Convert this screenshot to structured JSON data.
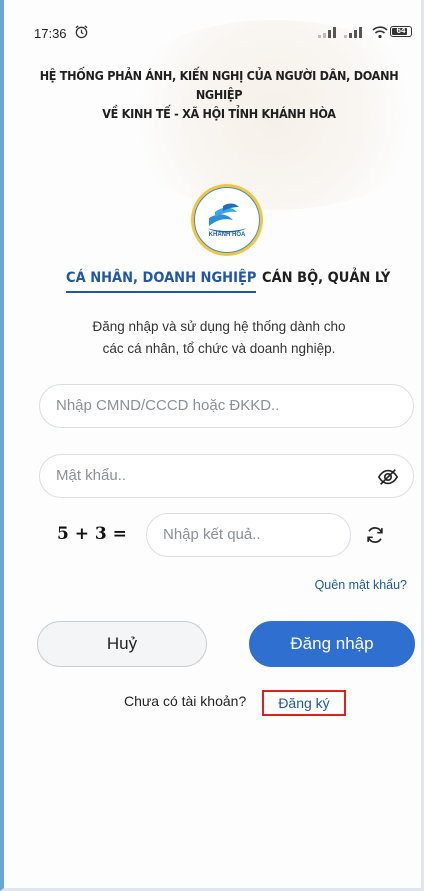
{
  "statusbar": {
    "time": "17:36",
    "battery": "64",
    "icons": [
      "alarm-icon",
      "signal-icon",
      "signal-icon",
      "wifi-icon",
      "battery-icon"
    ]
  },
  "header": {
    "title_line1": "HỆ THỐNG PHẢN ÁNH, KIẾN NGHỊ CỦA NGƯỜI DÂN, DOANH NGHIỆP",
    "title_line2": "VỀ KINH TẾ - XÃ HỘI TỈNH KHÁNH HÒA"
  },
  "logo": {
    "text": "KHÁNH HÒA"
  },
  "tabs": [
    {
      "label": "CÁ NHÂN, DOANH NGHIỆP",
      "active": true
    },
    {
      "label": "CÁN BỘ, QUẢN LÝ",
      "active": false
    }
  ],
  "description": {
    "line1": "Đăng nhập và sử dụng hệ thống dành cho",
    "line2": "các cá nhân, tổ chức và doanh nghiệp."
  },
  "form": {
    "id_placeholder": "Nhập CMND/CCCD hoặc ĐKKD..",
    "password_placeholder": "Mật khẩu..",
    "captcha_question": "5 + 3 =",
    "captcha_placeholder": "Nhập kết quả..",
    "forgot_password": "Quên mật khẩu?"
  },
  "buttons": {
    "cancel": "Huỷ",
    "login": "Đăng nhập"
  },
  "signup": {
    "question": "Chưa có tài khoản?",
    "link": "Đăng ký"
  },
  "colors": {
    "accent": "#1f56a8",
    "login_button": "#2f6fd0",
    "highlight_border": "#e02020"
  }
}
